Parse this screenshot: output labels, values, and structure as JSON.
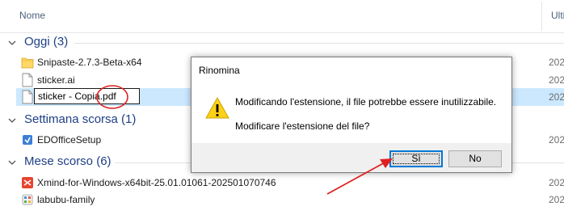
{
  "explorer": {
    "columns": {
      "name": "Nome",
      "date": "Ulti"
    },
    "groups": [
      {
        "title": "Oggi (3)"
      },
      {
        "title": "Settimana scorsa (1)"
      },
      {
        "title": "Mese scorso (6)"
      }
    ],
    "files": [
      {
        "name": "Snipaste-2.7.3-Beta-x64",
        "date": "202",
        "icon": "folder-icon"
      },
      {
        "name": "sticker.ai",
        "date": "202",
        "icon": "file-icon"
      },
      {
        "name": "",
        "date": "202",
        "icon": "file-icon"
      },
      {
        "name": "EDOfficeSetup",
        "date": "202",
        "icon": "installer-icon"
      },
      {
        "name": "Xmind-for-Windows-x64bit-25.01.01061-202501070746",
        "date": "202",
        "icon": "xmind-icon"
      },
      {
        "name": "labubu-family",
        "date": "202",
        "icon": "app-icon"
      }
    ],
    "rename_value": "sticker - Copia.pdf"
  },
  "dialog": {
    "title": "Rinomina",
    "message": "Modificando l'estensione, il file potrebbe essere inutilizzabile.",
    "question": "Modificare l'estensione del file?",
    "yes_label": "Sì",
    "no_label": "No"
  },
  "colors": {
    "group_title": "#1e3f85",
    "selection": "#cce8ff",
    "annotation": "#e02020",
    "focus_border": "#0078d7"
  }
}
